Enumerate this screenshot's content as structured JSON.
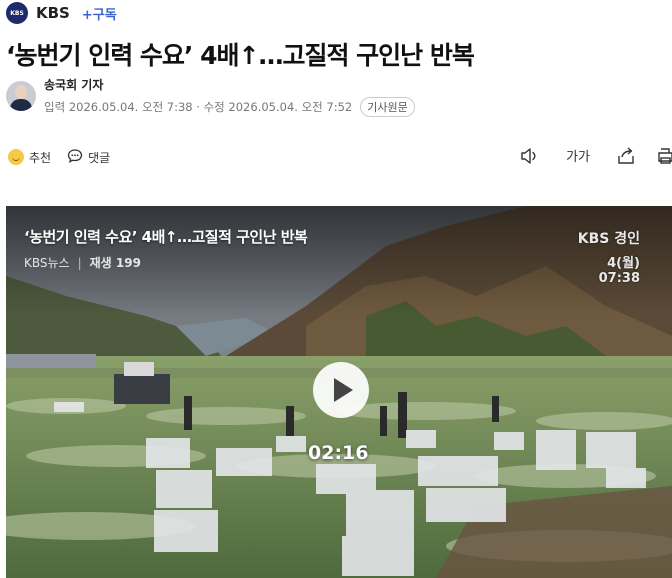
{
  "press": {
    "logo_text": "KBS",
    "name": "KBS",
    "subscribe_label": "+구독"
  },
  "article": {
    "headline": "‘농번기 인력 수요’ 4배↑…고질적 구인난 반복",
    "reporter": "송국회 기자",
    "published_label": "입력",
    "published": "2026.05.04. 오전 7:38",
    "modified_label": "수정",
    "modified": "2026.05.04. 오전 7:52",
    "original_button": "기사원문"
  },
  "actions": {
    "recommend": "추천",
    "comment": "댓글",
    "font_size_label": "가가"
  },
  "video": {
    "title": "‘농번기 인력 수요’ 4배↑…고질적 구인난 반복",
    "source": "KBS뉴스",
    "plays": "재생 199",
    "duration": "02:16",
    "bug_line1": "KBS 경인",
    "bug_line2": "4(월)",
    "bug_line3": "07:38"
  },
  "colors": {
    "accent": "#3a62d9",
    "logo": "#1d2a6b"
  }
}
